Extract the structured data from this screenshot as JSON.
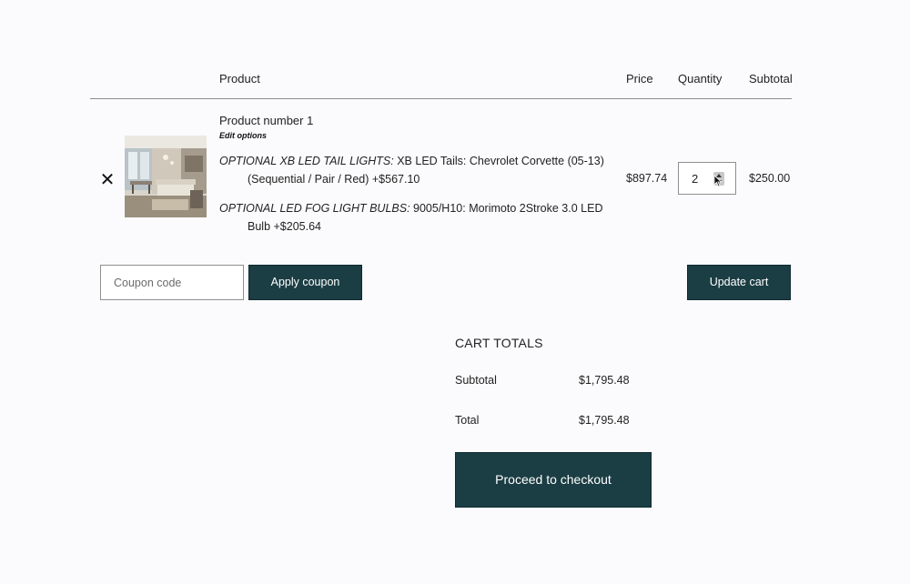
{
  "table_header": {
    "product": "Product",
    "price": "Price",
    "quantity": "Quantity",
    "subtotal": "Subtotal"
  },
  "cart_item": {
    "remove_icon": "close-icon",
    "remove_symbol": "✕",
    "thumbnail": "living-room-photo",
    "name": "Product number 1",
    "edit_options": "Edit options",
    "options": [
      {
        "label": "OPTIONAL XB LED TAIL LIGHTS:",
        "line1": "XB LED Tails: Chevrolet Corvette (05-13)",
        "line2": "(Sequential / Pair / Red) +$567.10"
      },
      {
        "label": "OPTIONAL LED FOG LIGHT BULBS:",
        "line1": "9005/H10: Morimoto 2Stroke 3.0 LED",
        "line2": "Bulb +$205.64"
      }
    ],
    "price": "$897.74",
    "quantity": "2",
    "subtotal": "$250.00"
  },
  "coupon": {
    "placeholder": "Coupon code",
    "value": "",
    "apply_label": "Apply coupon"
  },
  "update_cart_label": "Update cart",
  "cart_totals": {
    "title": "CART TOTALS",
    "subtotal_label": "Subtotal",
    "subtotal_value": "$1,795.48",
    "total_label": "Total",
    "total_value": "$1,795.48",
    "checkout_label": "Proceed to checkout"
  },
  "colors": {
    "button_bg": "#1b3d44",
    "button_text": "#ffffff",
    "page_bg": "#fbfbfd"
  }
}
